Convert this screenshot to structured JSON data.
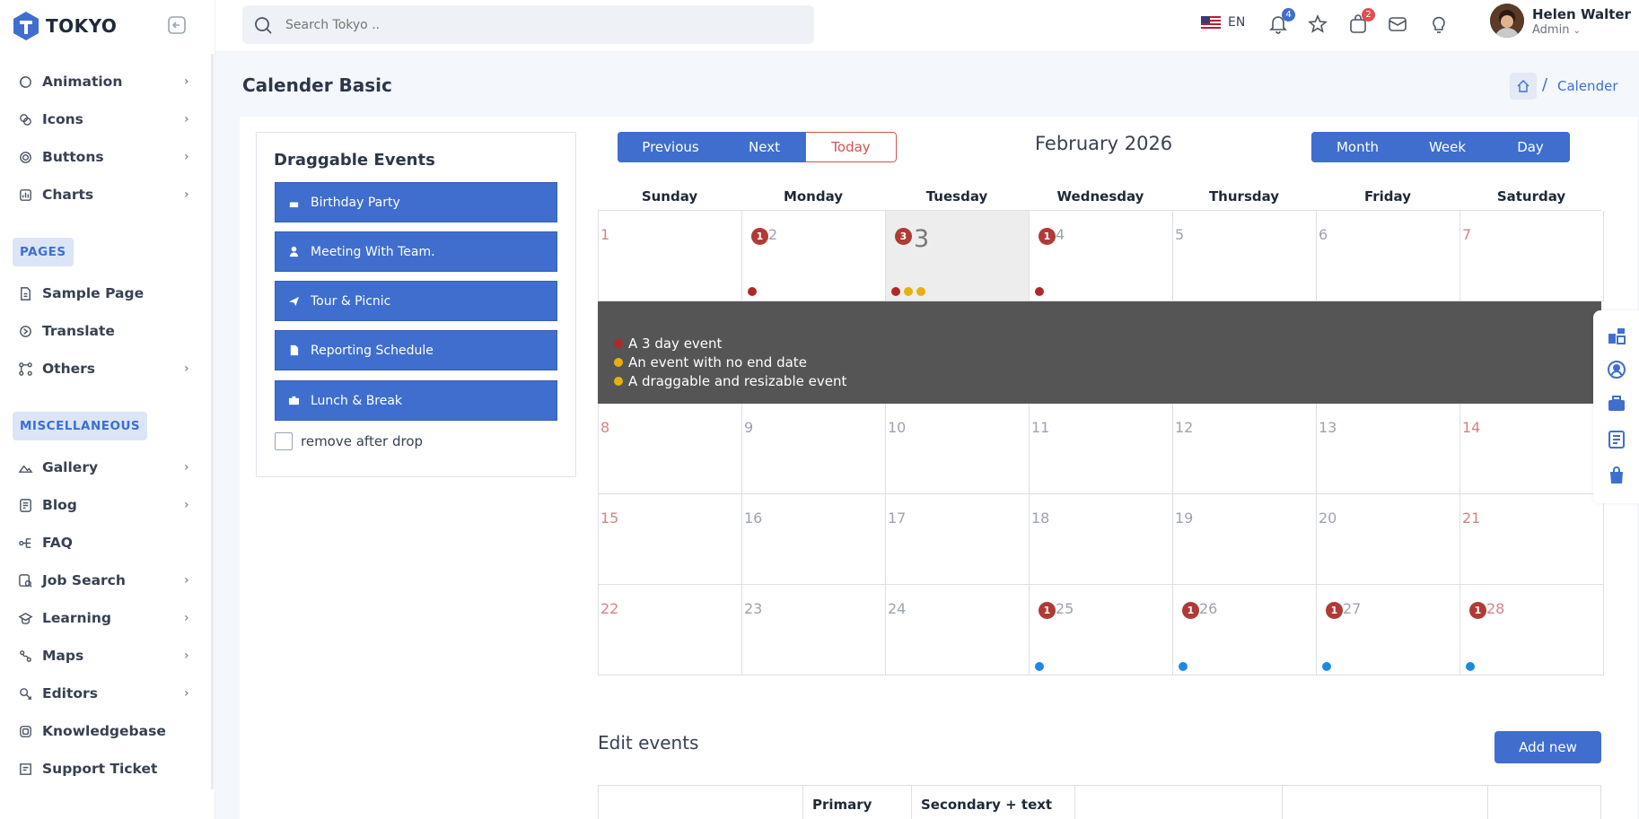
{
  "app": {
    "name": "TOKYO"
  },
  "sidebar": {
    "items": [
      {
        "label": "Animation",
        "icon": "animation-icon",
        "chevron": true
      },
      {
        "label": "Icons",
        "icon": "icons-icon",
        "chevron": true
      },
      {
        "label": "Buttons",
        "icon": "buttons-icon",
        "chevron": true
      },
      {
        "label": "Charts",
        "icon": "charts-icon",
        "chevron": true
      }
    ],
    "pages_label": "PAGES",
    "pages": [
      {
        "label": "Sample Page",
        "icon": "file-icon",
        "chevron": false
      },
      {
        "label": "Translate",
        "icon": "translate-icon",
        "chevron": false
      },
      {
        "label": "Others",
        "icon": "others-icon",
        "chevron": true
      }
    ],
    "misc_label": "MISCELLANEOUS",
    "misc": [
      {
        "label": "Gallery",
        "icon": "gallery-icon",
        "chevron": true
      },
      {
        "label": "Blog",
        "icon": "blog-icon",
        "chevron": true
      },
      {
        "label": "FAQ",
        "icon": "faq-icon",
        "chevron": false
      },
      {
        "label": "Job Search",
        "icon": "job-search-icon",
        "chevron": true
      },
      {
        "label": "Learning",
        "icon": "learning-icon",
        "chevron": true
      },
      {
        "label": "Maps",
        "icon": "maps-icon",
        "chevron": true
      },
      {
        "label": "Editors",
        "icon": "editors-icon",
        "chevron": true
      },
      {
        "label": "Knowledgebase",
        "icon": "knowledgebase-icon",
        "chevron": false
      },
      {
        "label": "Support Ticket",
        "icon": "support-ticket-icon",
        "chevron": false
      }
    ]
  },
  "header": {
    "search_placeholder": "Search Tokyo ..",
    "language": "EN",
    "notifications_count": "4",
    "cart_count": "2",
    "user": {
      "name": "Helen Walter",
      "role": "Admin"
    }
  },
  "page": {
    "title": "Calender Basic",
    "breadcrumb": "Calender"
  },
  "draggable": {
    "title": "Draggable Events",
    "events": [
      {
        "label": "Birthday Party",
        "icon": "cake-icon"
      },
      {
        "label": "Meeting With Team.",
        "icon": "user-icon"
      },
      {
        "label": "Tour & Picnic",
        "icon": "plane-icon"
      },
      {
        "label": "Reporting Schedule",
        "icon": "document-icon"
      },
      {
        "label": "Lunch & Break",
        "icon": "briefcase-icon"
      }
    ],
    "remove_after_drop": "remove after drop"
  },
  "calendar": {
    "prev": "Previous",
    "next": "Next",
    "today": "Today",
    "month_title": "February 2026",
    "views": [
      "Month",
      "Week",
      "Day"
    ],
    "weekdays": [
      "Sunday",
      "Monday",
      "Tuesday",
      "Wednesday",
      "Thursday",
      "Friday",
      "Saturday"
    ],
    "today_date": "3",
    "weeks": [
      [
        "1",
        "2",
        "3",
        "4",
        "5",
        "6",
        "7"
      ],
      [
        "8",
        "9",
        "10",
        "11",
        "12",
        "13",
        "14"
      ],
      [
        "15",
        "16",
        "17",
        "18",
        "19",
        "20",
        "21"
      ],
      [
        "22",
        "23",
        "24",
        "25",
        "26",
        "27",
        "28"
      ]
    ],
    "event_counts": {
      "2": "1",
      "3": "3",
      "4": "1",
      "25": "1",
      "26": "1",
      "27": "1",
      "28": "1"
    },
    "expanded_events": [
      {
        "label": "A 3 day event",
        "color": "#b0292a"
      },
      {
        "label": "An event with no end date",
        "color": "#e8b00c"
      },
      {
        "label": "A draggable and resizable event",
        "color": "#e8b00c"
      }
    ],
    "colors": {
      "red": "#b0292a",
      "yellow": "#e8b00c",
      "blue": "#1e88e5",
      "primary": "#3f6ece"
    }
  },
  "edit_events": {
    "title": "Edit events",
    "add_new": "Add new",
    "columns": [
      "",
      "Primary",
      "Secondary + text",
      "",
      "",
      ""
    ]
  }
}
